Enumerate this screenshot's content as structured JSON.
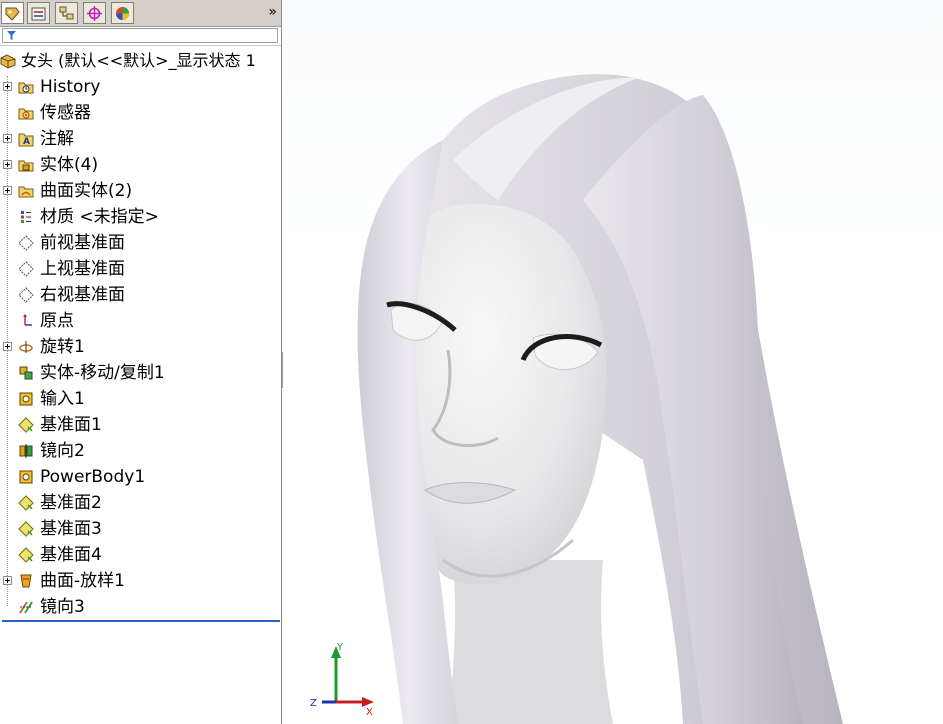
{
  "panel": {
    "tabs": [
      {
        "name": "featuremanager-tab",
        "icon": "feature-tree-icon",
        "active": true
      },
      {
        "name": "propertymanager-tab",
        "icon": "property-manager-icon",
        "active": false
      },
      {
        "name": "configurationmanager-tab",
        "icon": "configuration-manager-icon",
        "active": false
      },
      {
        "name": "dimxpert-tab",
        "icon": "dimxpert-crosshair-icon",
        "active": false
      },
      {
        "name": "displaymanager-tab",
        "icon": "display-manager-icon",
        "active": false
      }
    ],
    "expand_glyph": "»"
  },
  "tree": {
    "root": "女头 (默认<<默认>_显示状态 1",
    "items": [
      {
        "label": "History",
        "icon": "history-folder-icon",
        "expandable": true
      },
      {
        "label": "传感器",
        "icon": "sensors-folder-icon",
        "expandable": false
      },
      {
        "label": "注解",
        "icon": "annotations-folder-icon",
        "expandable": true
      },
      {
        "label": "实体(4)",
        "icon": "solid-bodies-folder-icon",
        "expandable": true
      },
      {
        "label": "曲面实体(2)",
        "icon": "surface-bodies-folder-icon",
        "expandable": true
      },
      {
        "label": "材质 <未指定>",
        "icon": "material-icon",
        "expandable": false
      },
      {
        "label": "前视基准面",
        "icon": "plane-icon",
        "expandable": false
      },
      {
        "label": "上视基准面",
        "icon": "plane-icon",
        "expandable": false
      },
      {
        "label": "右视基准面",
        "icon": "plane-icon",
        "expandable": false
      },
      {
        "label": "原点",
        "icon": "origin-icon",
        "expandable": false
      },
      {
        "label": "旋转1",
        "icon": "revolve-icon",
        "expandable": true
      },
      {
        "label": "实体-移动/复制1",
        "icon": "move-copy-body-icon",
        "expandable": false
      },
      {
        "label": "输入1",
        "icon": "imported-body-icon",
        "expandable": false
      },
      {
        "label": "基准面1",
        "icon": "ref-plane-icon",
        "expandable": false
      },
      {
        "label": "镜向2",
        "icon": "mirror-icon",
        "expandable": false
      },
      {
        "label": "PowerBody1",
        "icon": "powerbody-icon",
        "expandable": false
      },
      {
        "label": "基准面2",
        "icon": "ref-plane-icon",
        "expandable": false
      },
      {
        "label": "基准面3",
        "icon": "ref-plane-icon",
        "expandable": false
      },
      {
        "label": "基准面4",
        "icon": "ref-plane-icon",
        "expandable": false
      },
      {
        "label": "曲面-放样1",
        "icon": "surface-loft-icon",
        "expandable": true
      },
      {
        "label": "镜向3",
        "icon": "mirror-surface-icon",
        "expandable": false
      }
    ]
  },
  "triad": {
    "x": "X",
    "y": "Y",
    "z": "Z"
  },
  "colors": {
    "selection_line": "#2a62c9",
    "model_shade": "#dedde2",
    "panel_tabs": "#d4d0c8"
  }
}
